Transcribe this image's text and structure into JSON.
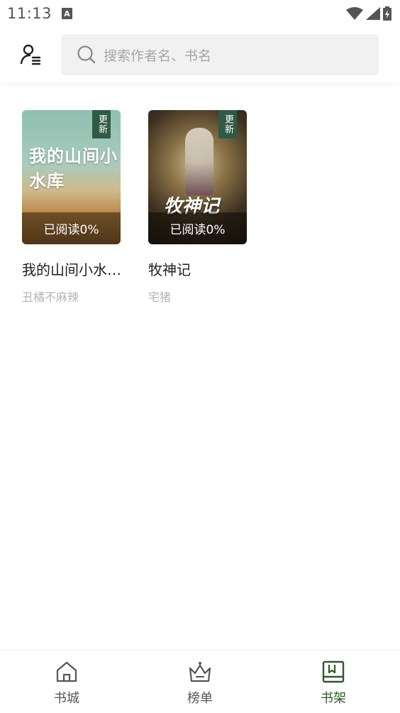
{
  "status_bar": {
    "time": "11:13",
    "app_icon_letter": "A"
  },
  "header": {
    "search_placeholder": "搜索作者名、书名"
  },
  "books": [
    {
      "title": "我的山间小水…",
      "author": "丑橘不麻辣",
      "cover_text": "我的山间小水库",
      "update_tag": "更新",
      "progress_text": "已阅读0%"
    },
    {
      "title": "牧神记",
      "author": "宅猪",
      "cover_text": "牧神记",
      "update_tag": "更新",
      "progress_text": "已阅读0%"
    }
  ],
  "bottom_nav": {
    "items": [
      {
        "label": "书城",
        "icon": "home-icon",
        "active": false
      },
      {
        "label": "榜单",
        "icon": "crown-icon",
        "active": false
      },
      {
        "label": "书架",
        "icon": "bookshelf-icon",
        "active": true
      }
    ]
  },
  "colors": {
    "accent": "#2e5a27",
    "update_tag": "#2f5a44"
  }
}
